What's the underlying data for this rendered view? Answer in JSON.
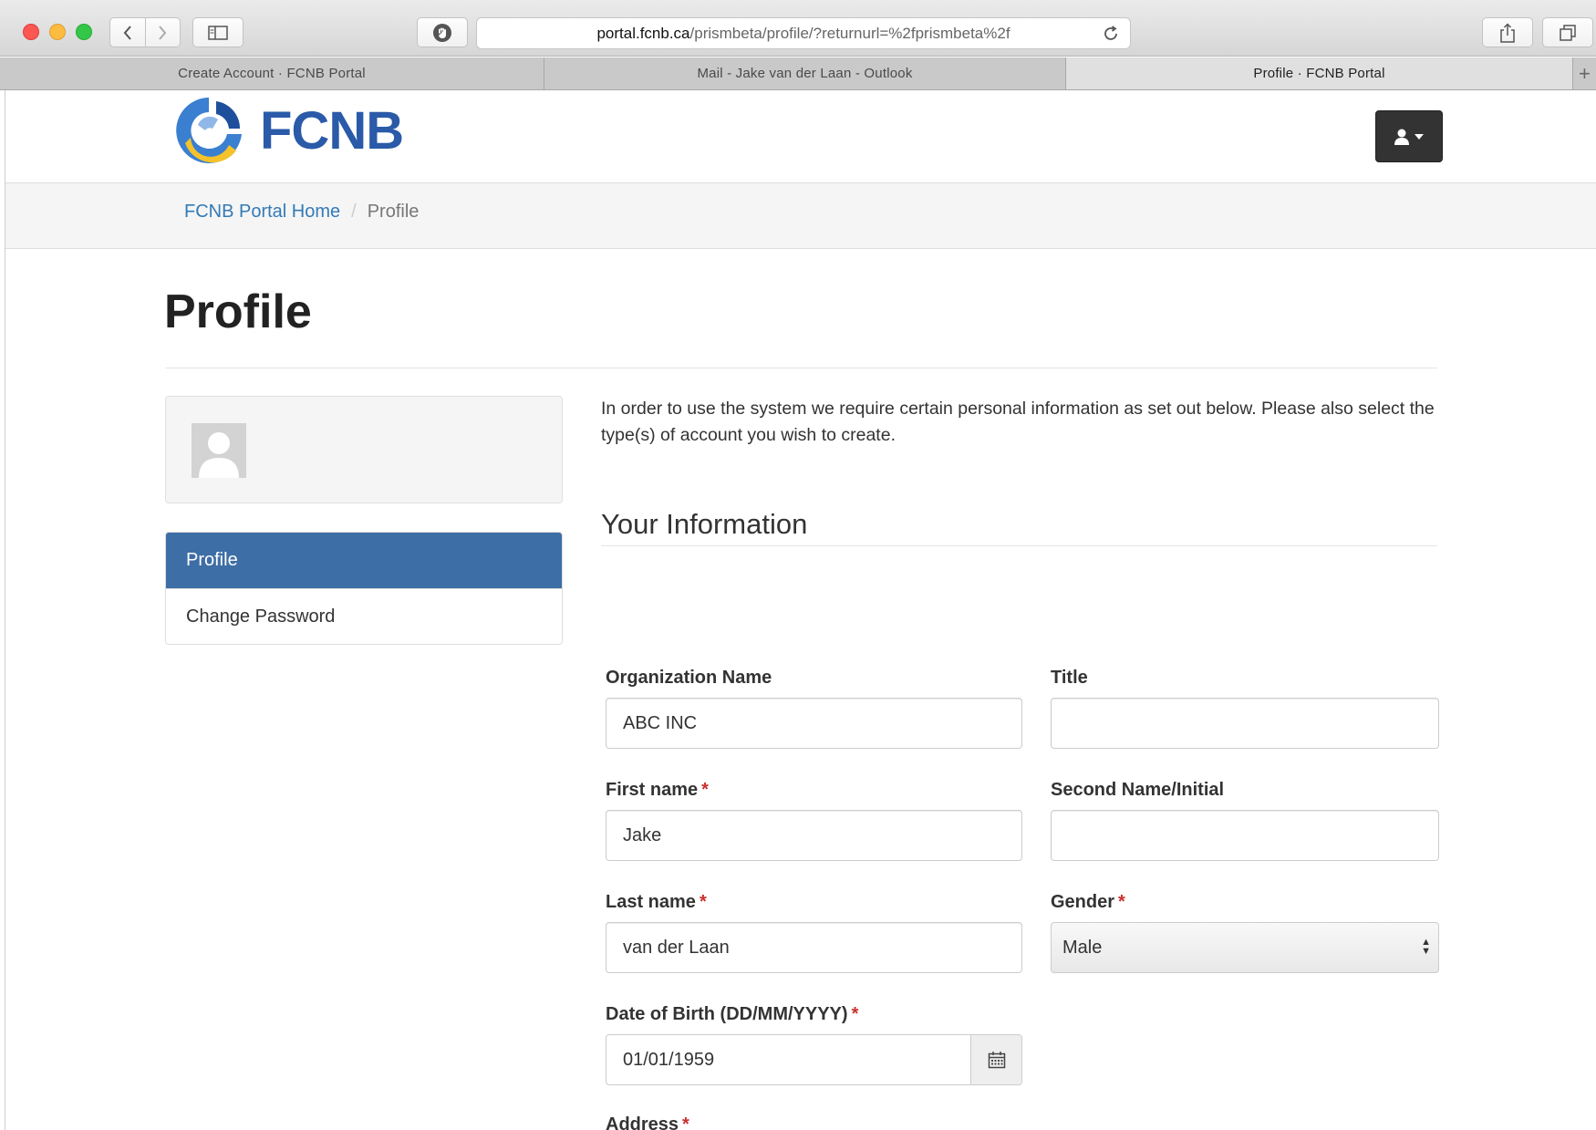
{
  "browser": {
    "url_host": "portal.fcnb.ca",
    "url_path": "/prismbeta/profile/?returnurl=%2fprismbeta%2f",
    "tabs": [
      {
        "label": "Create Account  · FCNB Portal"
      },
      {
        "label": "Mail - Jake van der Laan - Outlook"
      },
      {
        "label": "Profile  · FCNB Portal"
      }
    ],
    "new_tab": "+"
  },
  "header": {
    "logo_text": "FCNB"
  },
  "breadcrumb": {
    "home": "FCNB Portal Home",
    "separator": "/",
    "current": "Profile"
  },
  "page": {
    "title": "Profile"
  },
  "sidebar": {
    "items": [
      {
        "label": "Profile",
        "active": true
      },
      {
        "label": "Change Password",
        "active": false
      }
    ]
  },
  "form": {
    "intro": "In order to use the system we require certain personal information as set out below.  Please also select the type(s) of account you wish to create.",
    "section_title": "Your Information",
    "required_marker": "*",
    "fields": {
      "organization_name": {
        "label": "Organization Name",
        "value": "ABC INC"
      },
      "title": {
        "label": "Title",
        "value": ""
      },
      "first_name": {
        "label": "First name",
        "value": "Jake"
      },
      "second_name": {
        "label": "Second Name/Initial",
        "value": ""
      },
      "last_name": {
        "label": "Last name",
        "value": "van der Laan"
      },
      "gender": {
        "label": "Gender",
        "value": "Male"
      },
      "dob": {
        "label": "Date of Birth (DD/MM/YYYY)",
        "value": "01/01/1959"
      },
      "address": {
        "label": "Address"
      }
    }
  },
  "colors": {
    "brand_blue": "#2a5aa8",
    "active_nav": "#3d6ea5",
    "link": "#337ab7",
    "required": "#c9302c"
  },
  "icons": [
    "back-icon",
    "forward-icon",
    "sidebar-icon",
    "shield-icon",
    "reload-icon",
    "share-icon",
    "tabs-overview-icon",
    "user-icon",
    "caret-down-icon",
    "calendar-icon",
    "avatar-placeholder-icon"
  ]
}
